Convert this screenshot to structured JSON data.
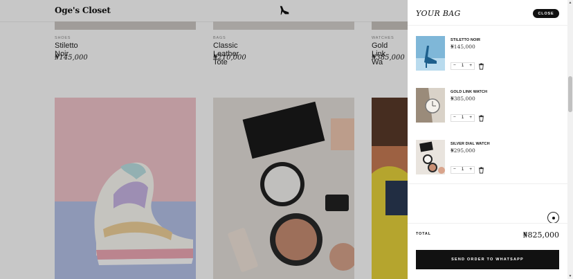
{
  "store": {
    "logo": "Oge's Closet",
    "products": [
      {
        "category": "SHOES",
        "name": "Stiletto Noir",
        "price": "₦145,000"
      },
      {
        "category": "BAGS",
        "name": "Classic Leather Tote",
        "price": "₦210,000"
      },
      {
        "category": "WATCHES",
        "name": "Gold Link Wa",
        "price": "₦385,000"
      }
    ]
  },
  "cart": {
    "title": "YOUR BAG",
    "close_label": "CLOSE",
    "items": [
      {
        "name": "STILETTO NOIR",
        "price": "₦145,000",
        "qty": "1",
        "minus": "−",
        "plus": "+"
      },
      {
        "name": "GOLD LINK WATCH",
        "price": "₦385,000",
        "qty": "1",
        "minus": "−",
        "plus": "+"
      },
      {
        "name": "SILVER DIAL WATCH",
        "price": "₦295,000",
        "qty": "1",
        "minus": "−",
        "plus": "+"
      }
    ],
    "total_label": "TOTAL",
    "total_value": "₦825,000",
    "send_label": "SEND ORDER TO WHATSAPP"
  },
  "icons": {
    "logo": "high-heel-icon",
    "trash": "trash-icon",
    "scroll": "scroll-indicator-icon"
  },
  "colors": {
    "accent": "#111111",
    "background": "#ffffff"
  }
}
